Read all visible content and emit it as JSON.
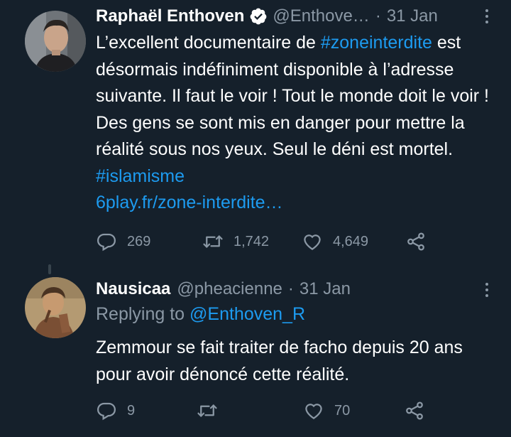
{
  "tweets": [
    {
      "author_name": "Raphaël Enthoven",
      "handle": "@Enthove…",
      "separator": "·",
      "date": "31 Jan",
      "verified": true,
      "text_segments": [
        "L’excellent documentaire de ",
        "#zoneinterdite",
        " est désormais indéfiniment disponible à l’adresse suivante. Il faut le voir ! Tout le monde doit le voir ! Des gens se sont mis en danger pour mettre la réalité sous nos yeux. Seul le déni est mortel. ",
        "#islamisme",
        "6play.fr/zone-interdite…"
      ],
      "replies": "269",
      "retweets": "1,742",
      "likes": "4,649"
    },
    {
      "author_name": "Nausicaa",
      "handle": "@pheacienne",
      "separator": "·",
      "date": "31 Jan",
      "replying_label": "Replying to ",
      "replying_handle": "@Enthoven_R",
      "text": "Zemmour se fait traiter de facho depuis 20 ans pour avoir dénoncé cette réalité.",
      "replies": "9",
      "retweets": "",
      "likes": "70"
    }
  ],
  "colors": {
    "background": "#15202b",
    "text": "#ffffff",
    "muted": "#8b98a5",
    "link": "#1d9bf0",
    "thread_line": "#38444d"
  },
  "icons": [
    "verified-badge-icon",
    "more-options-icon",
    "reply-icon",
    "retweet-icon",
    "like-icon",
    "share-icon"
  ]
}
